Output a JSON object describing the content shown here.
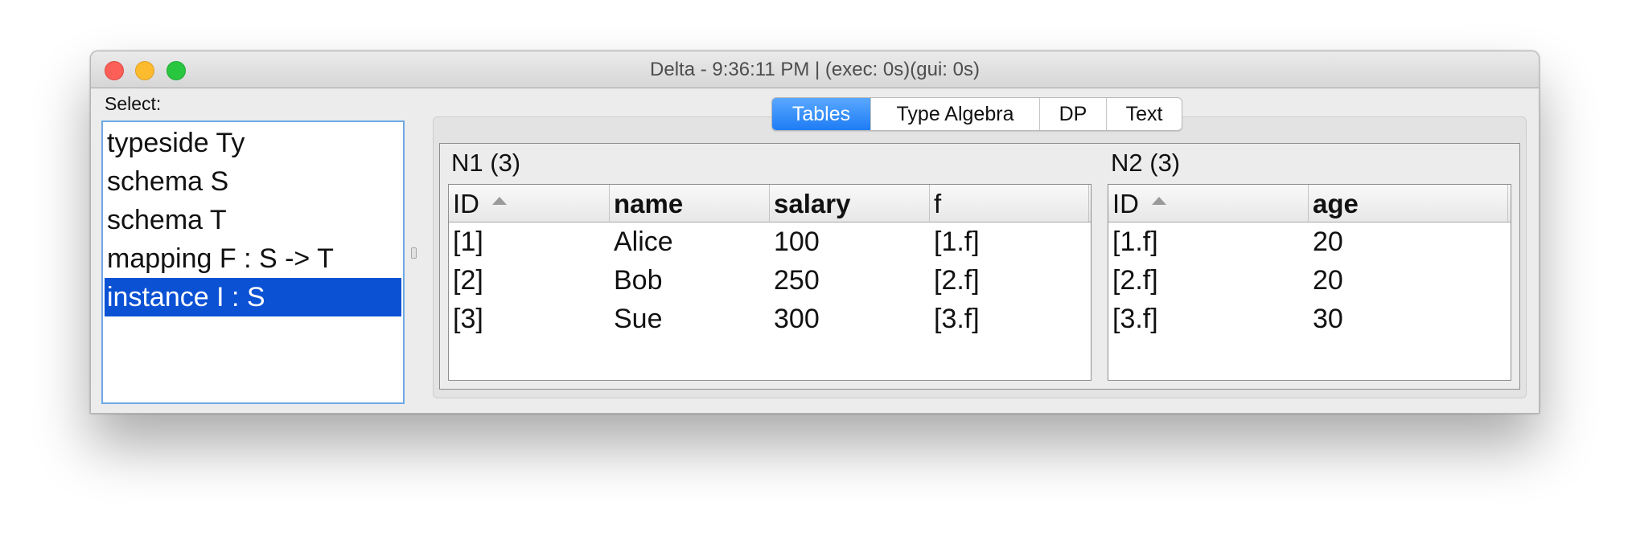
{
  "window": {
    "title": "Delta - 9:36:11 PM | (exec: 0s)(gui: 0s)"
  },
  "sidebar": {
    "label": "Select:",
    "items": [
      {
        "label": "typeside Ty",
        "selected": false
      },
      {
        "label": "schema S",
        "selected": false
      },
      {
        "label": "schema T",
        "selected": false
      },
      {
        "label": "mapping F : S -> T",
        "selected": false
      },
      {
        "label": "instance I : S",
        "selected": true
      }
    ]
  },
  "tabs": [
    {
      "label": "Tables",
      "active": true
    },
    {
      "label": "Type Algebra",
      "active": false
    },
    {
      "label": "DP",
      "active": false
    },
    {
      "label": "Text",
      "active": false
    }
  ],
  "tables": {
    "n1": {
      "title": "N1 (3)",
      "columns": [
        "ID",
        "name",
        "salary",
        "f"
      ],
      "rows": [
        [
          "[1]",
          "Alice",
          "100",
          "[1.f]"
        ],
        [
          "[2]",
          "Bob",
          "250",
          "[2.f]"
        ],
        [
          "[3]",
          "Sue",
          "300",
          "[3.f]"
        ]
      ]
    },
    "n2": {
      "title": "N2 (3)",
      "columns": [
        "ID",
        "age"
      ],
      "rows": [
        [
          "[1.f]",
          "20"
        ],
        [
          "[2.f]",
          "20"
        ],
        [
          "[3.f]",
          "30"
        ]
      ]
    }
  },
  "colors": {
    "selection": "#0b51d4",
    "active_tab": "#1e7cf5",
    "close": "#fc5f57",
    "minimize": "#fdbb2e",
    "zoom": "#29c740"
  }
}
